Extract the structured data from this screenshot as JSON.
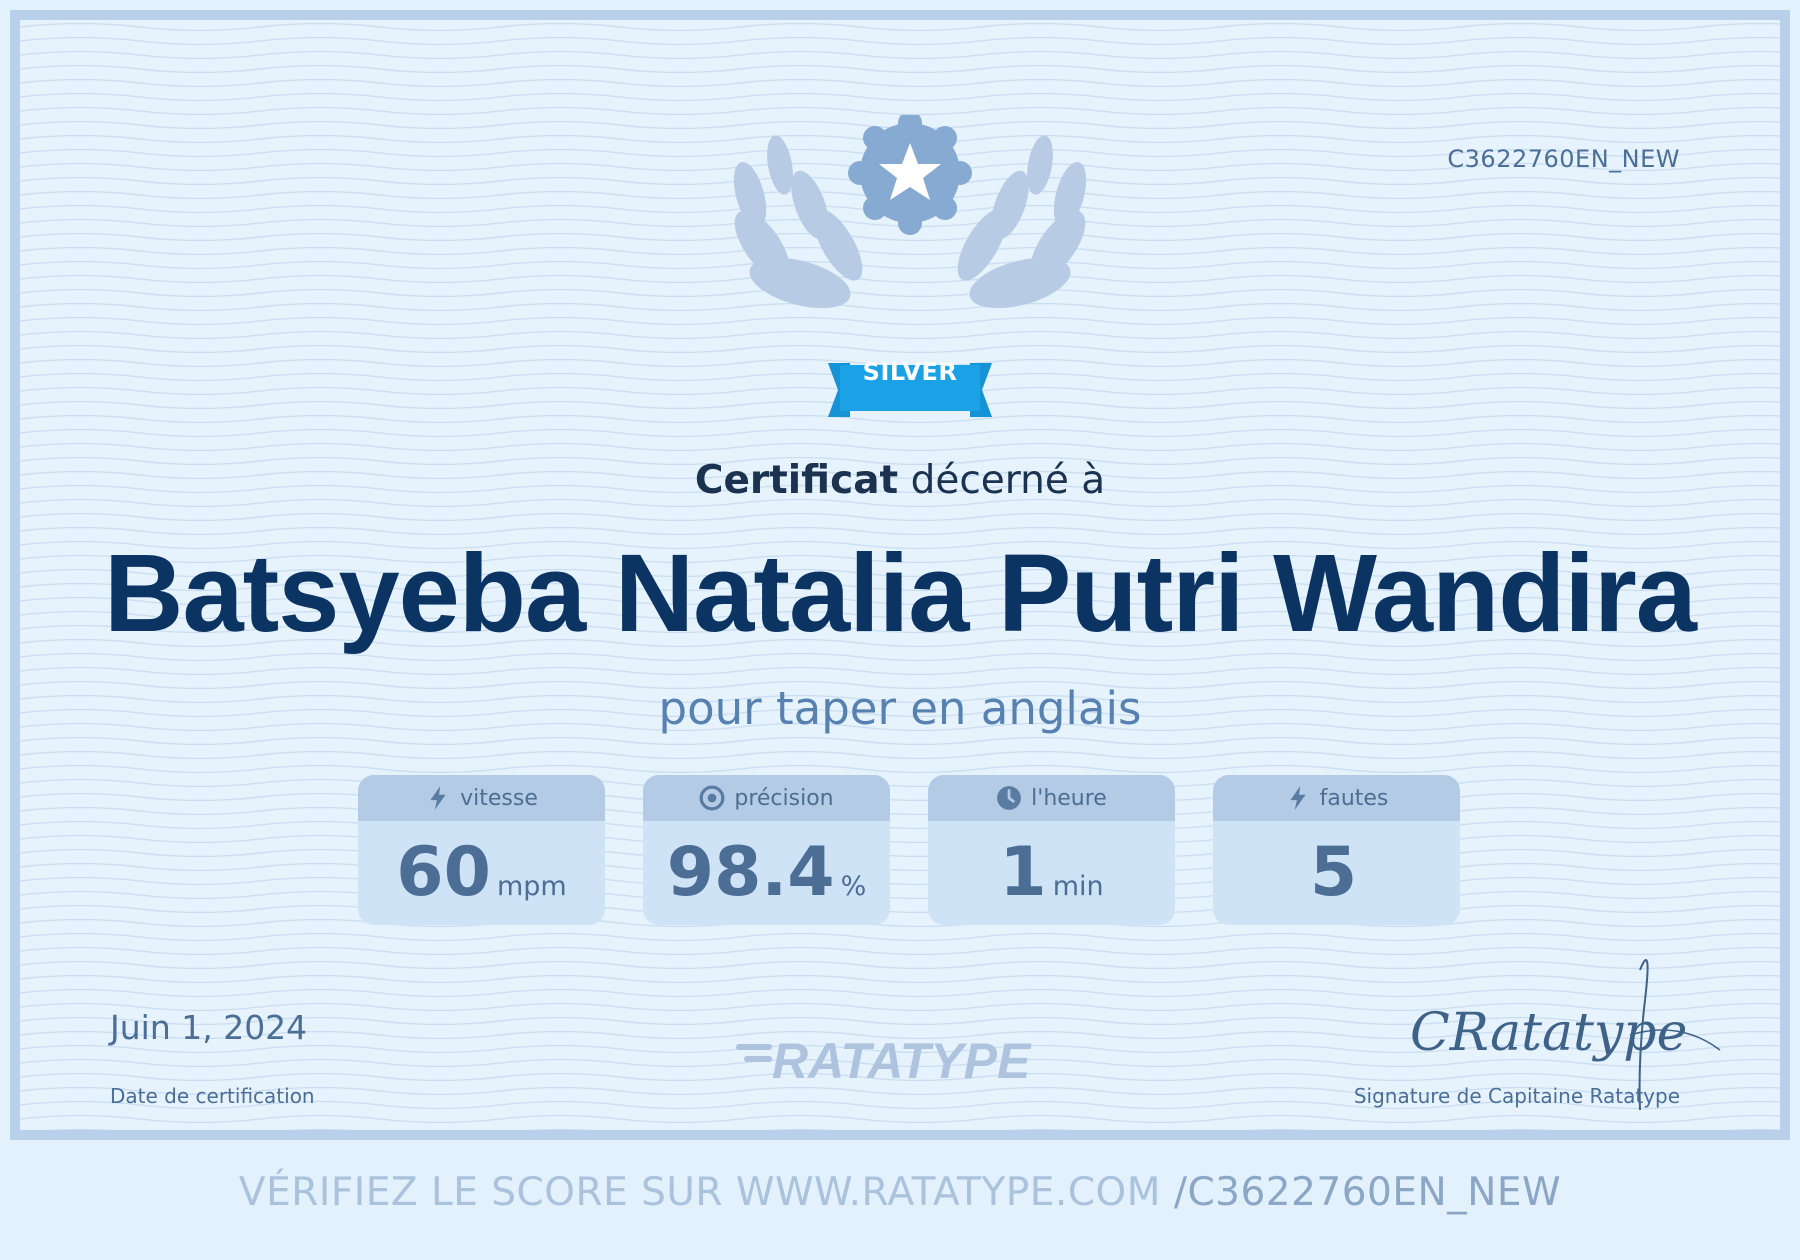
{
  "certificate": {
    "code": "C3622760EN_NEW",
    "badge": "SILVER",
    "awarded_bold": "Certificat",
    "awarded_rest": " décerné à",
    "recipient": "Batsyeba Natalia Putri Wandira",
    "subtitle": "pour taper en anglais"
  },
  "stats": [
    {
      "label": "vitesse",
      "value": "60",
      "unit": "mpm",
      "icon": "lightning-icon"
    },
    {
      "label": "précision",
      "value": "98.4",
      "unit": "%",
      "icon": "target-icon"
    },
    {
      "label": "l'heure",
      "value": "1",
      "unit": "min",
      "icon": "clock-icon"
    },
    {
      "label": "fautes",
      "value": "5",
      "unit": "",
      "icon": "lightning-icon"
    }
  ],
  "footer": {
    "date": "Juin 1, 2024",
    "date_caption": "Date de certification",
    "logo_text": "RATATYPE",
    "signature_text": "CRatatype",
    "signature_caption": "Signature de Capitaine Ratatype"
  },
  "verify": {
    "prefix": "VÉRIFIEZ LE SCORE SUR WWW.RATATYPE.COM",
    "code": "/C3622760EN_NEW"
  },
  "colors": {
    "accent": "#1aa1e6",
    "name": "#0c3462",
    "border": "#b9d0ea",
    "background": "#e6f2fc"
  }
}
